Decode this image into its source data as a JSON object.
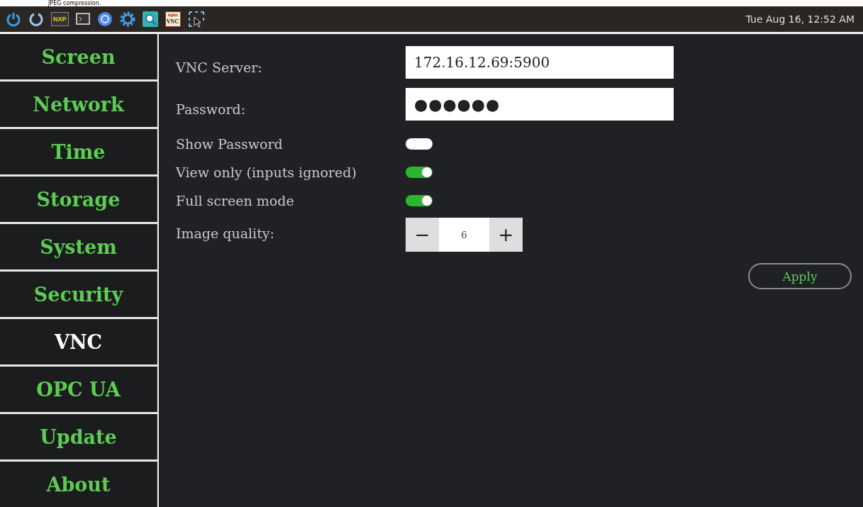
{
  "caption": "JPEG compression.",
  "taskbar": {
    "clock": "Tue Aug 16, 12:52 AM",
    "apps": [
      {
        "kind": "power"
      },
      {
        "kind": "restart"
      },
      {
        "kind": "nxp",
        "label": "NXP"
      },
      {
        "kind": "terminal"
      },
      {
        "kind": "browser"
      },
      {
        "kind": "gear"
      },
      {
        "kind": "search"
      },
      {
        "kind": "vnc",
        "label": "tight",
        "label2": "VNC"
      },
      {
        "kind": "select"
      }
    ]
  },
  "sidebar": {
    "items": [
      {
        "label": "Screen",
        "selected": false
      },
      {
        "label": "Network",
        "selected": false
      },
      {
        "label": "Time",
        "selected": false
      },
      {
        "label": "Storage",
        "selected": false
      },
      {
        "label": "System",
        "selected": false
      },
      {
        "label": "Security",
        "selected": false
      },
      {
        "label": "VNC",
        "selected": true
      },
      {
        "label": "OPC UA",
        "selected": false
      },
      {
        "label": "Update",
        "selected": false
      },
      {
        "label": "About",
        "selected": false
      }
    ]
  },
  "form": {
    "rows": [
      {
        "kind": "text",
        "label": "VNC Server:",
        "value": "172.16.12.69:5900"
      },
      {
        "kind": "password",
        "label": "Password:",
        "value": "●●●●●●"
      },
      {
        "kind": "switch",
        "label": "Show Password",
        "on": false
      },
      {
        "kind": "switch",
        "label": "View only (inputs ignored)",
        "on": true
      },
      {
        "kind": "switch",
        "label": "Full screen mode",
        "on": true
      },
      {
        "kind": "stepper",
        "label": "Image quality:",
        "minus": "−",
        "value": "6",
        "plus": "+"
      }
    ],
    "apply": "Apply"
  }
}
